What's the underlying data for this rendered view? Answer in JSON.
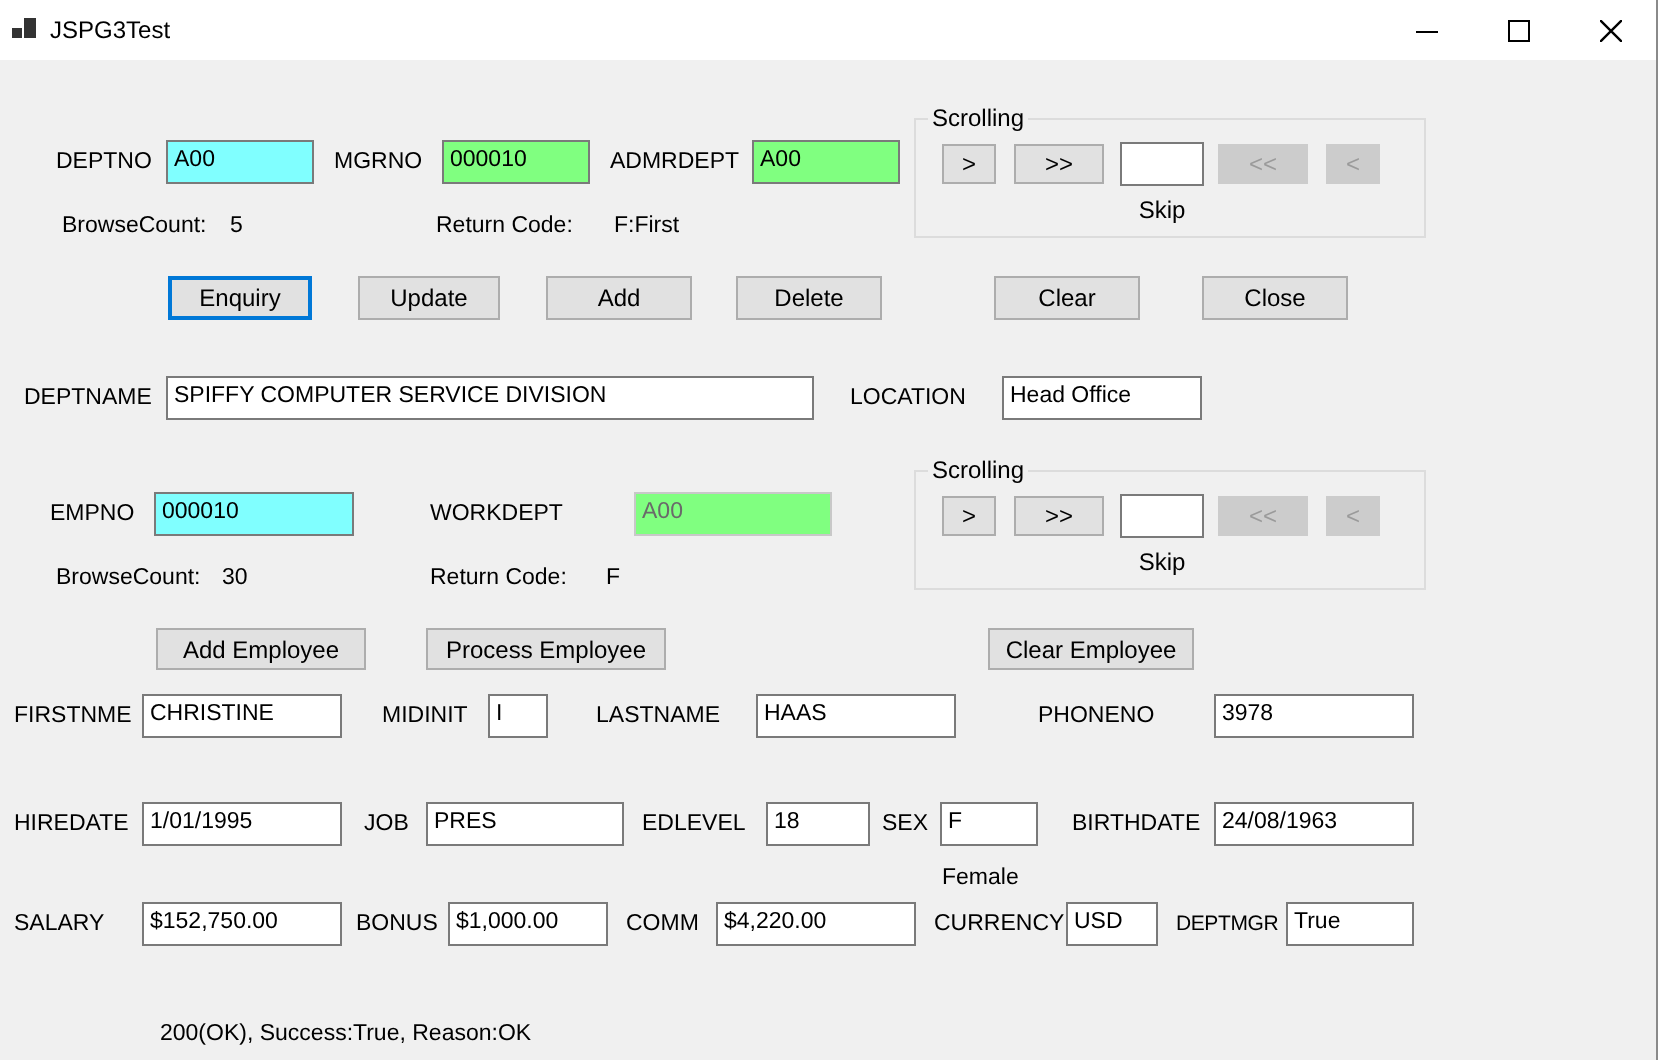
{
  "window": {
    "title": "JSPG3Test"
  },
  "department": {
    "fields": [
      {
        "label": "DEPTNO",
        "value": "A00",
        "kind": "key",
        "disabled": false
      },
      {
        "label": "MGRNO",
        "value": "000010",
        "kind": "lookup",
        "disabled": false
      },
      {
        "label": "ADMRDEPT",
        "value": "A00",
        "kind": "lookup",
        "disabled": false
      }
    ],
    "browse_count": {
      "label": "BrowseCount:",
      "value": "5"
    },
    "return_code": {
      "label": "Return Code:",
      "value": "F:First"
    },
    "scrolling": {
      "title": "Scrolling",
      "skip_label": "Skip",
      "buttons": [
        {
          "label": ">",
          "disabled": false
        },
        {
          "label": ">>",
          "disabled": false
        },
        {
          "label": "<<",
          "disabled": true
        },
        {
          "label": "<",
          "disabled": true
        }
      ]
    },
    "buttons": [
      {
        "label": "Enquiry",
        "focused": true
      },
      {
        "label": "Update",
        "focused": false
      },
      {
        "label": "Add",
        "focused": false
      },
      {
        "label": "Delete",
        "focused": false
      },
      {
        "label": "Clear",
        "focused": false
      },
      {
        "label": "Close",
        "focused": false
      }
    ],
    "details": [
      {
        "label": "DEPTNAME",
        "value": "SPIFFY COMPUTER SERVICE DIVISION",
        "kind": "plain",
        "disabled": false
      },
      {
        "label": "LOCATION",
        "value": "Head Office",
        "kind": "plain",
        "disabled": false
      }
    ]
  },
  "employee": {
    "fields": [
      {
        "label": "EMPNO",
        "value": "000010",
        "kind": "key",
        "disabled": false
      },
      {
        "label": "WORKDEPT",
        "value": "A00",
        "kind": "lookup",
        "disabled": true
      }
    ],
    "browse_count": {
      "label": "BrowseCount:",
      "value": "30"
    },
    "return_code": {
      "label": "Return Code:",
      "value": "F"
    },
    "scrolling": {
      "title": "Scrolling",
      "skip_label": "Skip",
      "buttons": [
        {
          "label": ">",
          "disabled": false
        },
        {
          "label": ">>",
          "disabled": false
        },
        {
          "label": "<<",
          "disabled": true
        },
        {
          "label": "<",
          "disabled": true
        }
      ]
    },
    "buttons": [
      {
        "label": "Add Employee",
        "focused": false
      },
      {
        "label": "Process Employee",
        "focused": false
      },
      {
        "label": "Clear Employee",
        "focused": false
      }
    ],
    "rows": [
      {
        "fields": [
          {
            "label": "FIRSTNME",
            "value": "CHRISTINE",
            "kind": "plain",
            "disabled": false
          },
          {
            "label": "MIDINIT",
            "value": "I",
            "kind": "plain",
            "disabled": false
          },
          {
            "label": "LASTNAME",
            "value": "HAAS",
            "kind": "plain",
            "disabled": false
          },
          {
            "label": "PHONENO",
            "value": "3978",
            "kind": "plain",
            "disabled": false
          }
        ]
      },
      {
        "fields": [
          {
            "label": "HIREDATE",
            "value": "1/01/1995",
            "kind": "plain",
            "disabled": false
          },
          {
            "label": "JOB",
            "value": "PRES",
            "kind": "plain",
            "disabled": false
          },
          {
            "label": "EDLEVEL",
            "value": "18",
            "kind": "plain",
            "disabled": false
          },
          {
            "label": "SEX",
            "value": "F",
            "kind": "plain",
            "disabled": false
          },
          {
            "label": "BIRTHDATE",
            "value": "24/08/1963",
            "kind": "plain",
            "disabled": false
          }
        ]
      },
      {
        "fields": [
          {
            "label": "SALARY",
            "value": "$152,750.00",
            "kind": "plain",
            "disabled": false
          },
          {
            "label": "BONUS",
            "value": "$1,000.00",
            "kind": "plain",
            "disabled": false
          },
          {
            "label": "COMM",
            "value": "$4,220.00",
            "kind": "plain",
            "disabled": false
          },
          {
            "label": "CURRENCY",
            "value": "USD",
            "kind": "plain",
            "disabled": false
          },
          {
            "label": "DEPTMGR",
            "value": "True",
            "kind": "plain",
            "disabled": false
          }
        ]
      }
    ],
    "sex_description": "Female"
  },
  "status": "200(OK), Success:True, Reason:OK"
}
